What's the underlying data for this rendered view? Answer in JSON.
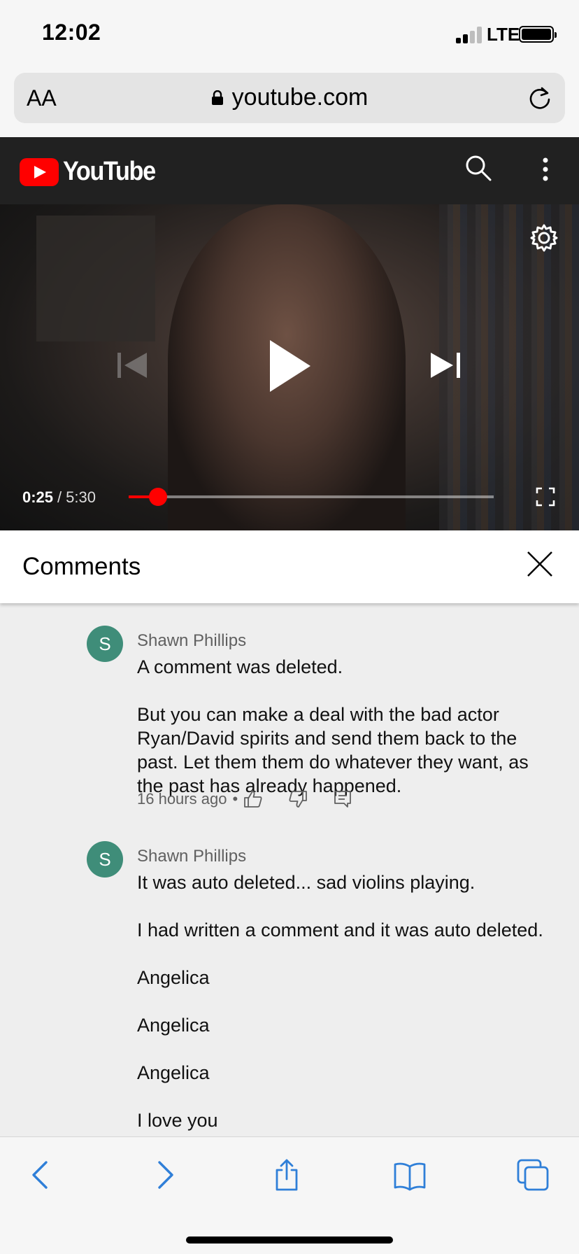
{
  "status_bar": {
    "time": "12:02",
    "network": "LTE"
  },
  "browser": {
    "text_size_label": "AA",
    "url": "youtube.com",
    "accent_color": "#2f7fd8"
  },
  "youtube": {
    "logo_text": "YouTube",
    "brand_color": "#ff0000"
  },
  "player": {
    "current_time": "0:25",
    "separator": "/",
    "total_time": "5:30",
    "progress_fraction": 0.08
  },
  "comments": {
    "title": "Comments",
    "items": [
      {
        "avatar_letter": "S",
        "author": "Shawn Phillips",
        "paragraphs": [
          "A comment was deleted.",
          "But you can make a deal with the bad actor Ryan/David spirits and send them back to the past. Let them them do whatever they want, as the past has already happened."
        ],
        "timestamp": "16 hours ago"
      },
      {
        "avatar_letter": "S",
        "author": "Shawn Phillips",
        "paragraphs": [
          "It was auto deleted... sad violins playing.",
          "I had written a comment and it was auto deleted.",
          "Angelica",
          "Angelica",
          "Angelica",
          "I love you"
        ]
      }
    ]
  }
}
